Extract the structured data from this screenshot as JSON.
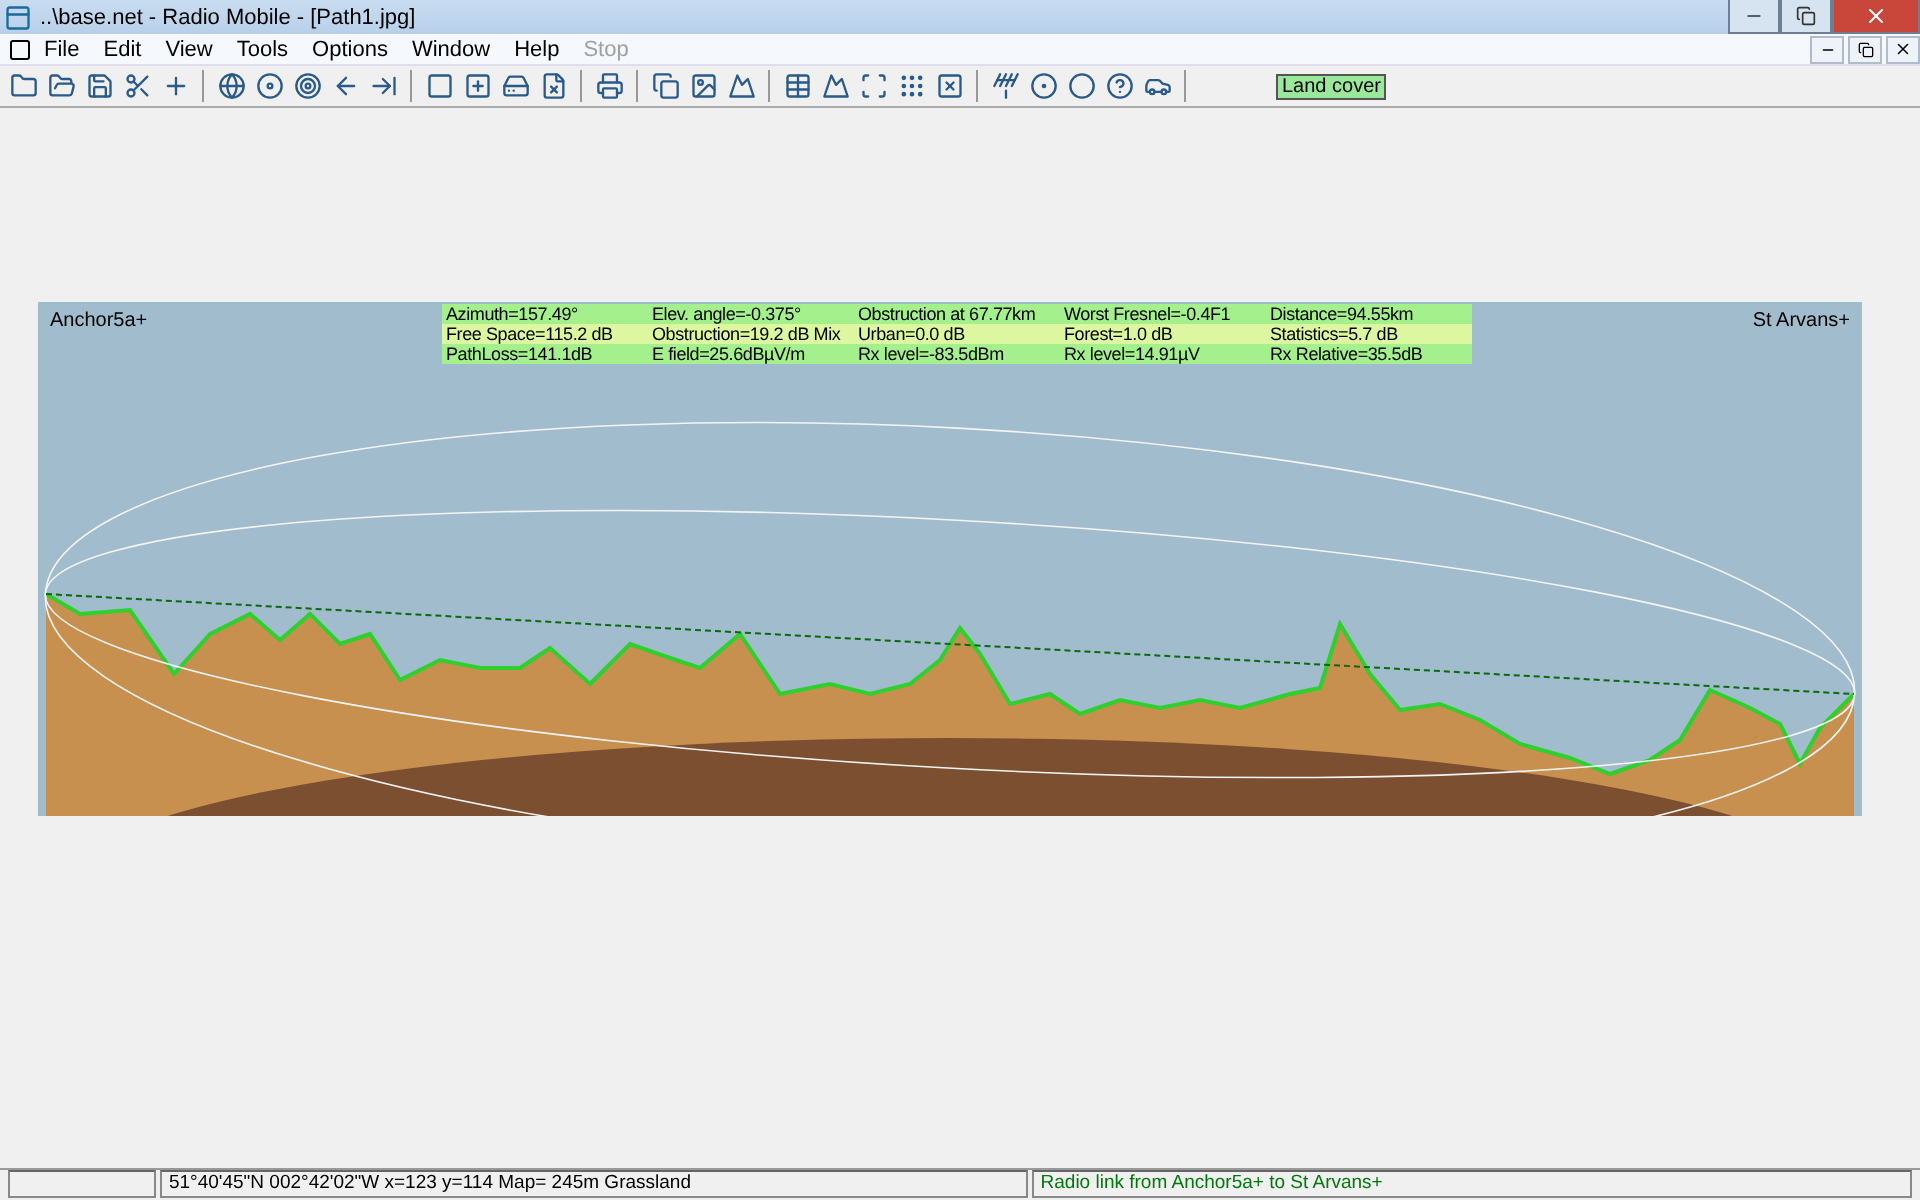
{
  "window": {
    "title": "..\\base.net - Radio Mobile - [Path1.jpg]"
  },
  "menu": [
    {
      "label": "File",
      "disabled": false
    },
    {
      "label": "Edit",
      "disabled": false
    },
    {
      "label": "View",
      "disabled": false
    },
    {
      "label": "Tools",
      "disabled": false
    },
    {
      "label": "Options",
      "disabled": false
    },
    {
      "label": "Window",
      "disabled": false
    },
    {
      "label": "Help",
      "disabled": false
    },
    {
      "label": "Stop",
      "disabled": true
    }
  ],
  "toolbar": {
    "land_cover": {
      "label": "Land cover",
      "on": true
    }
  },
  "profile": {
    "left_label": "Anchor5a+",
    "right_label": "St Arvans+",
    "info_rows": [
      [
        "Azimuth=157.49°",
        "Elev. angle=-0.375°",
        "Obstruction at 67.77km",
        "Worst Fresnel=-0.4F1",
        "Distance=94.55km"
      ],
      [
        "Free Space=115.2 dB",
        "Obstruction=19.2 dB Mix",
        "Urban=0.0 dB",
        "Forest=1.0 dB",
        "Statistics=5.7 dB"
      ],
      [
        "PathLoss=141.1dB",
        "E field=25.6dBµV/m",
        "Rx level=-83.5dBm",
        "Rx level=14.91µV",
        "Rx Relative=35.5dB"
      ]
    ]
  },
  "status_bar": {
    "coordinates": "51°40'45\"N  002°42'02\"W   x=123 y=114 Map= 245m Grassland",
    "message": "Radio link from Anchor5a+ to St Arvans+"
  }
}
